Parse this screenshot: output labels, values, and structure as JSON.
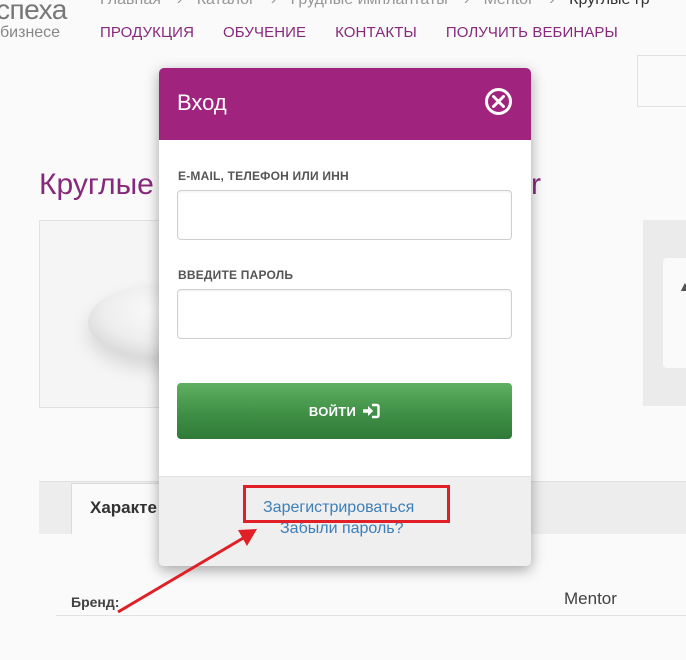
{
  "site": {
    "logo_line1": "спеха",
    "logo_line2": "бизнесе"
  },
  "breadcrumbs": [
    "Главная",
    "Каталог",
    "Грудные имплантаты",
    "Mentor",
    "Круглые гр"
  ],
  "nav": [
    "ПРОДУКЦИЯ",
    "ОБУЧЕНИЕ",
    "КОНТАКТЫ",
    "ПОЛУЧИТЬ ВЕБИНАРЫ"
  ],
  "product": {
    "title_start": "Круглые",
    "title_end": "r",
    "tab_label": "Характе",
    "brand_label": "Бренд:",
    "brand_value": "Mentor"
  },
  "modal": {
    "title": "Вход",
    "close_icon": "close-circle-icon",
    "login_label": "E-MAIL, ТЕЛЕФОН ИЛИ ИНН",
    "login_value": "",
    "password_label": "ВВЕДИТЕ ПАРОЛЬ",
    "password_value": "",
    "submit_label": "ВОЙТИ",
    "submit_icon": "sign-in-icon",
    "register_link": "Зарегистрироваться",
    "forgot_link": "Забыли пароль?"
  },
  "colors": {
    "brand": "#a0247e",
    "nav": "#8a2a7e",
    "button": "#3f8f46",
    "link": "#3d7fb8",
    "annotation": "#e01f26"
  }
}
